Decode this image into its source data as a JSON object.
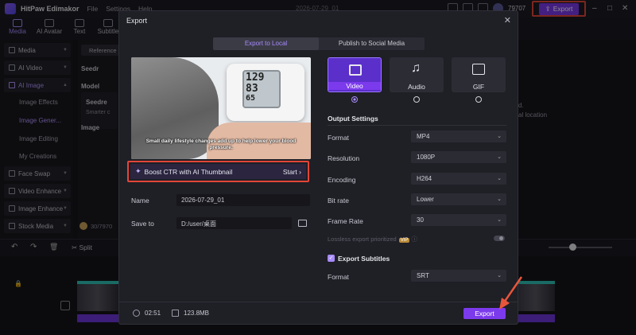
{
  "app": {
    "name": "HitPaw Edimakor",
    "menu": [
      "File",
      "Settings",
      "Help"
    ],
    "project_name": "2026-07-29_01",
    "coins": "79707",
    "top_export_label": "Export"
  },
  "toolbar": {
    "items": [
      "Media",
      "AI Avatar",
      "Text",
      "Subtitle"
    ]
  },
  "sidebar": {
    "groups": [
      "Media",
      "AI Video",
      "AI Image",
      "Face Swap",
      "Video Enhance",
      "Image Enhance",
      "Stock Media"
    ],
    "subitems": [
      "Image Effects",
      "Image Gener...",
      "Image Editing",
      "My Creations"
    ]
  },
  "panel": {
    "tab": "Reference",
    "seed_label": "Seedr",
    "model_label": "Model",
    "model_name": "Seedre",
    "model_desc": "Smarter c",
    "image_label": "Image",
    "credits": "30/7970"
  },
  "background": {
    "right_text_1": "d.",
    "right_text_2": "al location"
  },
  "timeline": {
    "split_label": "Split"
  },
  "modal": {
    "title": "Export",
    "tabs": [
      "Export to Local",
      "Publish to Social Media"
    ],
    "preview_caption": "Small daily lifestyle changes add up to help lower your blood pressure.",
    "screen_numbers": [
      "129",
      "83",
      "65"
    ],
    "boost_label": "Boost CTR with AI Thumbnail",
    "boost_start": "Start",
    "name_label": "Name",
    "name_value": "2026-07-29_01",
    "save_label": "Save to",
    "save_value": "D:/user/桌面",
    "formats": [
      "Video",
      "Audio",
      "GIF"
    ],
    "selected_format": "Video",
    "output_settings_title": "Output Settings",
    "settings": [
      {
        "label": "Format",
        "value": "MP4"
      },
      {
        "label": "Resolution",
        "value": "1080P"
      },
      {
        "label": "Encoding",
        "value": "H264"
      },
      {
        "label": "Bit rate",
        "value": "Lower"
      },
      {
        "label": "Frame Rate",
        "value": "30"
      }
    ],
    "lossless_label": "Lossless export prioritized",
    "vip_badge": "VIP",
    "subtitles_title": "Export Subtitles",
    "subtitle_format_label": "Format",
    "subtitle_format_value": "SRT",
    "duration": "02:51",
    "file_size": "123.8MB",
    "export_label": "Export"
  },
  "colors": {
    "accent": "#7c3aed",
    "highlight_border": "#e2453a",
    "arrow": "#e8553b"
  }
}
